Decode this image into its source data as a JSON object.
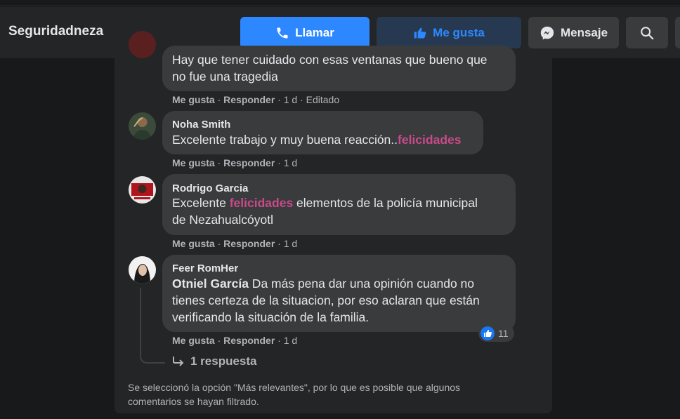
{
  "header": {
    "page_name": "Seguridadneza",
    "call_label": "Llamar",
    "like_label": "Me gusta",
    "message_label": "Mensaje",
    "search_icon": "search-icon"
  },
  "comments": [
    {
      "text_line1": "Hay que tener cuidado con esas ventanas que bueno que",
      "text_line2": "no fue una tragedia",
      "like": "Me gusta",
      "reply": "Responder",
      "time": "1 d",
      "edited": "Editado"
    },
    {
      "author": "Noha Smith",
      "text_pre": "Excelente trabajo y muy buena reacción..",
      "text_hl": "felicidades",
      "like": "Me gusta",
      "reply": "Responder",
      "time": "1 d"
    },
    {
      "author": "Rodrigo Garcia",
      "text_pre": "Excelente ",
      "text_hl": "felicidades",
      "text_post": " elementos de la policía municipal",
      "text_line2": "de Nezahualcóyotl",
      "like": "Me gusta",
      "reply": "Responder",
      "time": "1 d"
    },
    {
      "author": "Feer RomHer",
      "mention": "Otniel García",
      "text_line1": " Da más pena dar una opinión cuando no",
      "text_line2": "tienes certeza de la situacion, por eso aclaran que están",
      "text_line3": "verificando la situación de la familia.",
      "reactions": "11",
      "like": "Me gusta",
      "reply": "Responder",
      "time": "1 d"
    }
  ],
  "replies_label": "1 respuesta",
  "filter_note_line1": "Se seleccionó la opción \"Más relevantes\", por lo que es posible que algunos",
  "filter_note_line2": "comentarios se hayan filtrado.",
  "colors": {
    "background": "#18191a",
    "surface": "#242526",
    "bubble": "#3a3b3c",
    "accent": "#2d88ff",
    "highlight": "#c84a8b",
    "secondary_text": "#b0b3b8"
  }
}
